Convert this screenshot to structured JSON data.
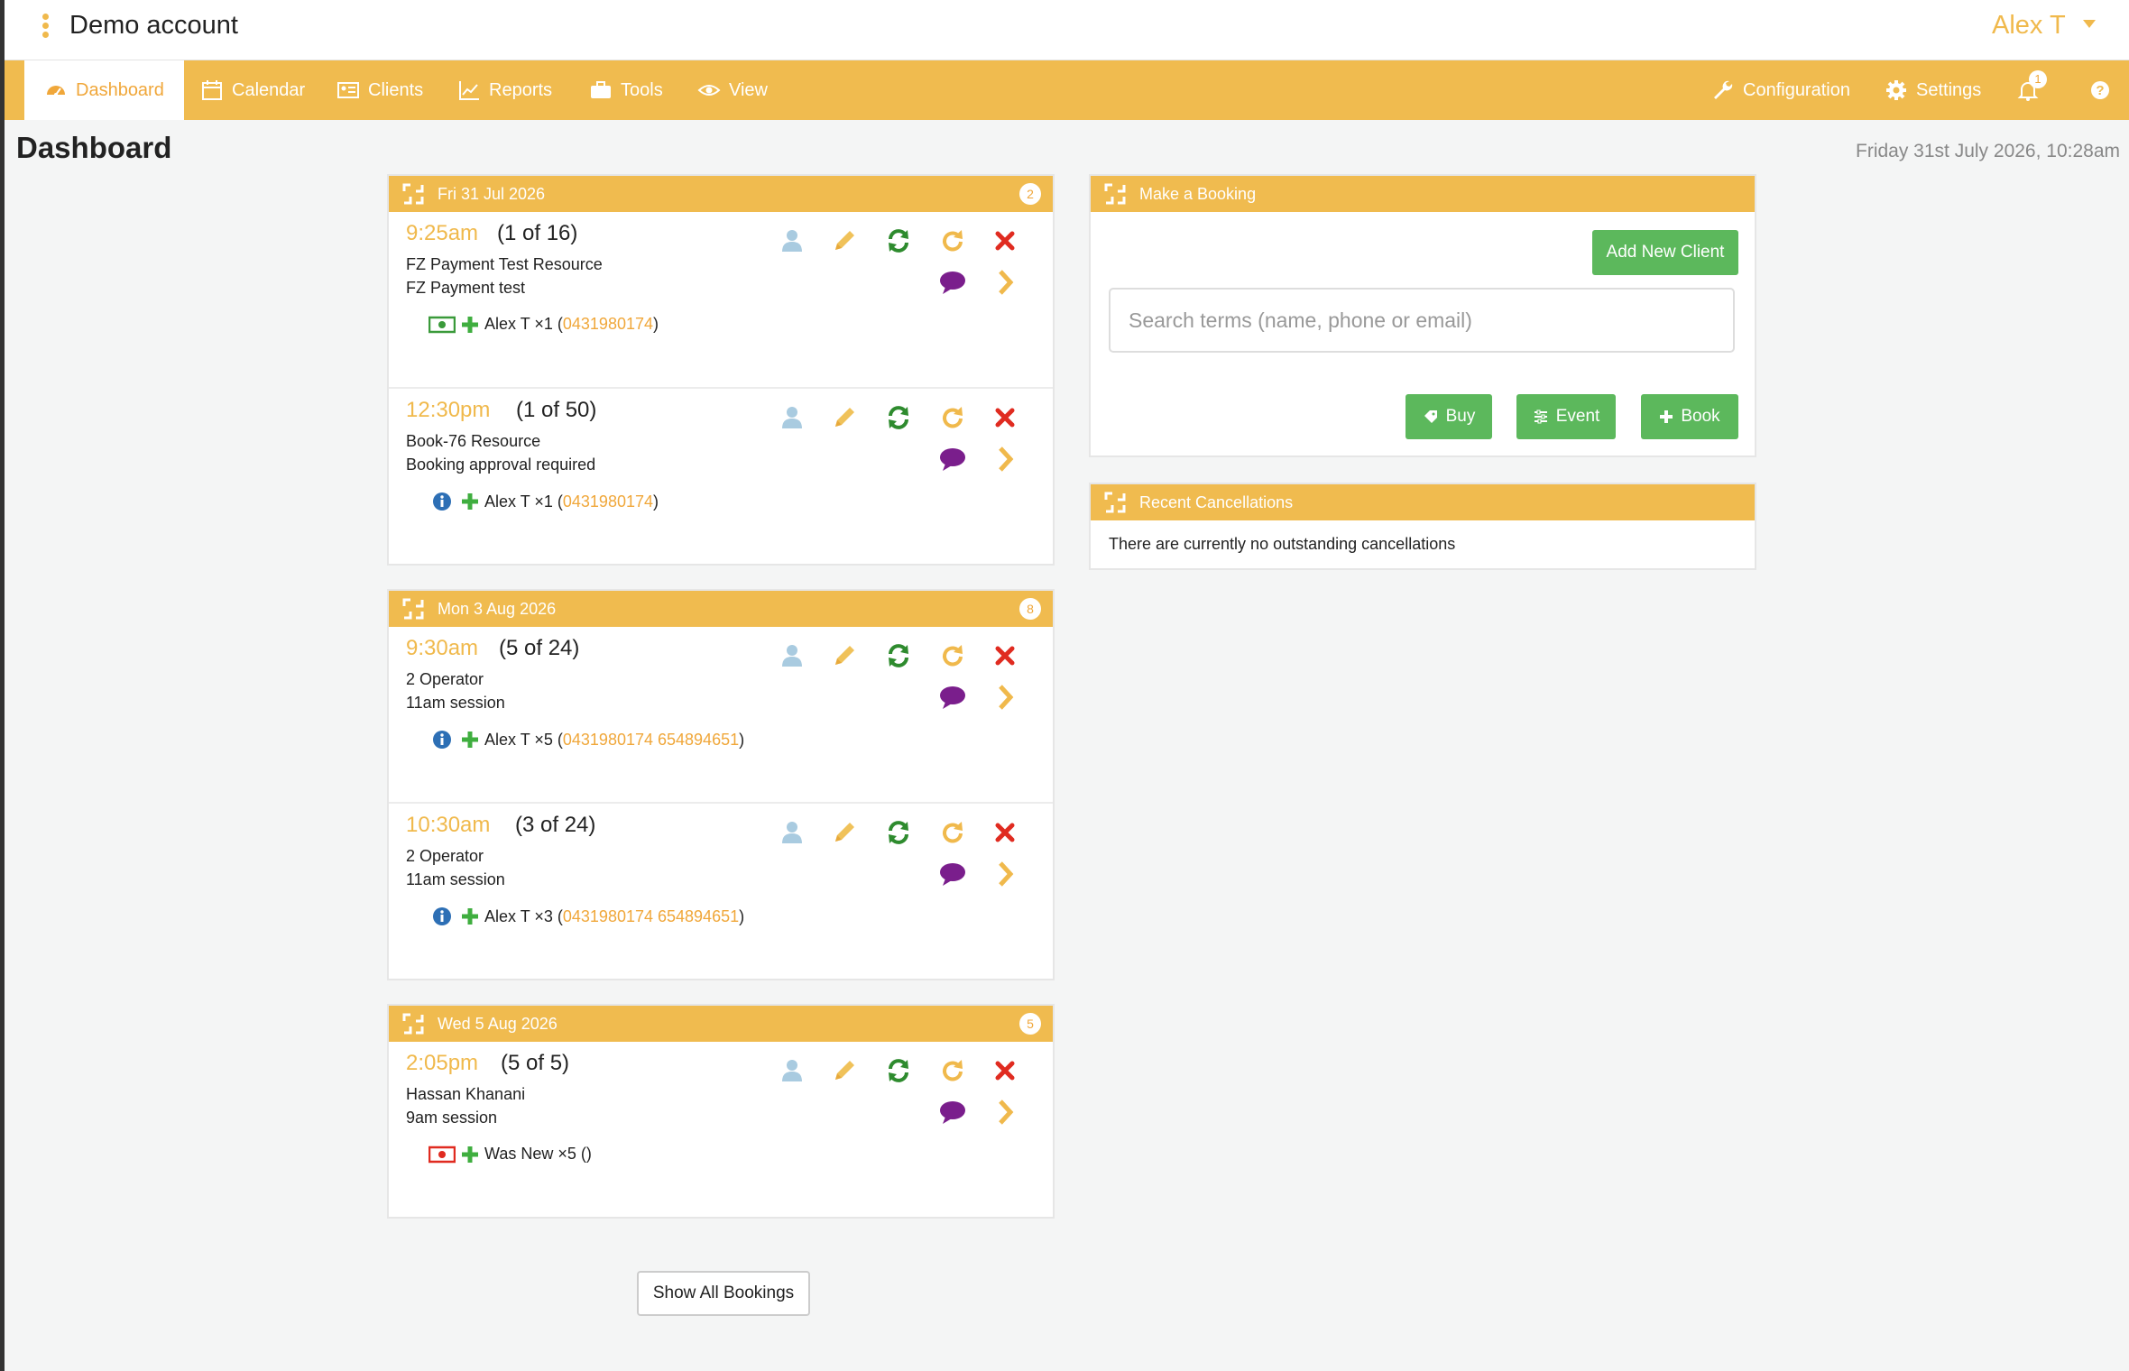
{
  "account": {
    "title": "Demo account",
    "user": "Alex T"
  },
  "nav": {
    "dashboard": "Dashboard",
    "calendar": "Calendar",
    "clients": "Clients",
    "reports": "Reports",
    "tools": "Tools",
    "view": "View",
    "configuration": "Configuration",
    "settings": "Settings",
    "notifications_count": "1"
  },
  "page": {
    "title": "Dashboard",
    "datetime": "Friday 31st July 2026, 10:28am"
  },
  "days": [
    {
      "date": "Fri 31 Jul 2026",
      "count": "2",
      "bookings": [
        {
          "time": "9:25am",
          "count": "(1 of 16)",
          "line1": "FZ Payment Test Resource",
          "line2": "FZ Payment test",
          "status_icon": "paid-cash-icon",
          "client": "Alex T ×1 (",
          "phone": "0431980174",
          "close": ")"
        },
        {
          "time": "12:30pm",
          "count": "(1 of 50)",
          "line1": "Book-76 Resource",
          "line2": "Booking approval required",
          "status_icon": "info-icon",
          "client": "Alex T ×1 (",
          "phone": "0431980174",
          "close": ")"
        }
      ]
    },
    {
      "date": "Mon 3 Aug 2026",
      "count": "8",
      "bookings": [
        {
          "time": "9:30am",
          "count": "(5 of 24)",
          "line1": "2 Operator",
          "line2": "11am session",
          "status_icon": "info-icon",
          "client": "Alex T ×5 (",
          "phone": "0431980174 654894651",
          "close": ")"
        },
        {
          "time": "10:30am",
          "count": "(3 of 24)",
          "line1": "2 Operator",
          "line2": "11am session",
          "status_icon": "info-icon",
          "client": "Alex T ×3 (",
          "phone": "0431980174 654894651",
          "close": ")"
        }
      ]
    },
    {
      "date": "Wed 5 Aug 2026",
      "count": "5",
      "bookings": [
        {
          "time": "2:05pm",
          "count": "(5 of 5)",
          "line1": "Hassan Khanani",
          "line2": "9am session",
          "status_icon": "unpaid-cash-icon",
          "client": "Was New ×5 ()",
          "phone": "",
          "close": ""
        }
      ]
    }
  ],
  "make_booking": {
    "title": "Make a Booking",
    "add_client": "Add New Client",
    "search_placeholder": "Search terms (name, phone or email)",
    "buy": "Buy",
    "event": "Event",
    "book": "Book"
  },
  "cancellations": {
    "title": "Recent Cancellations",
    "message": "There are currently no outstanding cancellations"
  },
  "show_all": "Show All Bookings",
  "colors": {
    "accent": "#f0bb4f",
    "green": "#5cb85c",
    "cancel": "#e02b20",
    "chat": "#7a1e8c",
    "refresh": "#2e8b2e"
  }
}
